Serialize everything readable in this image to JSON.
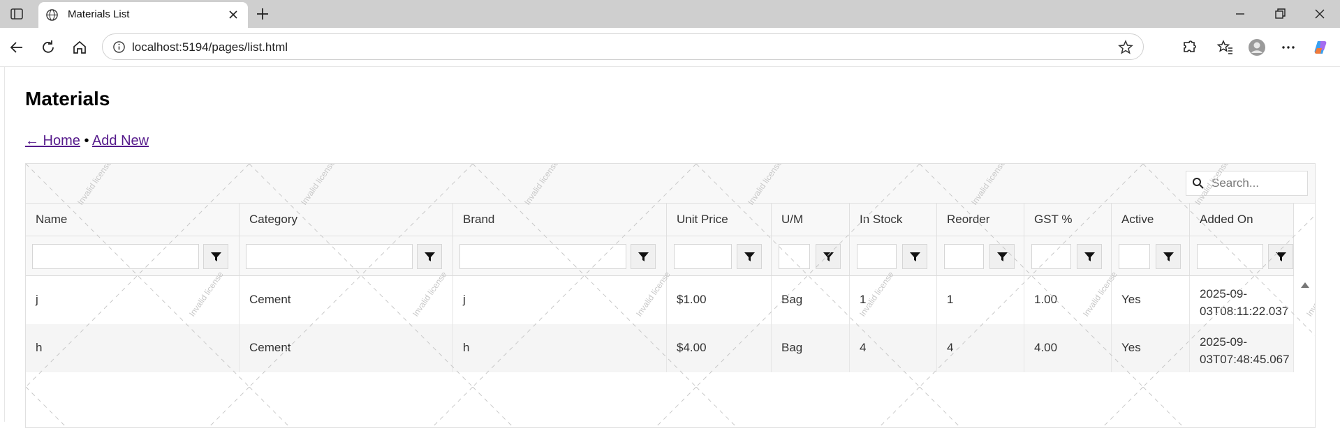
{
  "browser": {
    "tab_title": "Materials List",
    "url": "localhost:5194/pages/list.html"
  },
  "page": {
    "title": "Materials",
    "home_link": "← Home",
    "separator": "•",
    "add_new_link": "Add New"
  },
  "grid": {
    "search_placeholder": "Search...",
    "columns": [
      "Name",
      "Category",
      "Brand",
      "Unit Price",
      "U/M",
      "In Stock",
      "Reorder",
      "GST %",
      "Active",
      "Added On"
    ],
    "rows": [
      {
        "name": "j",
        "category": "Cement",
        "brand": "j",
        "unit_price": "$1.00",
        "um": "Bag",
        "in_stock": "1",
        "reorder": "1",
        "gst": "1.00",
        "active": "Yes",
        "added_on_1": "2025-09-",
        "added_on_2": "03T08:11:22.037"
      },
      {
        "name": "h",
        "category": "Cement",
        "brand": "h",
        "unit_price": "$4.00",
        "um": "Bag",
        "in_stock": "4",
        "reorder": "4",
        "gst": "4.00",
        "active": "Yes",
        "added_on_1": "2025-09-",
        "added_on_2": "03T07:48:45.067"
      }
    ],
    "watermark_text": "Invalid license"
  }
}
